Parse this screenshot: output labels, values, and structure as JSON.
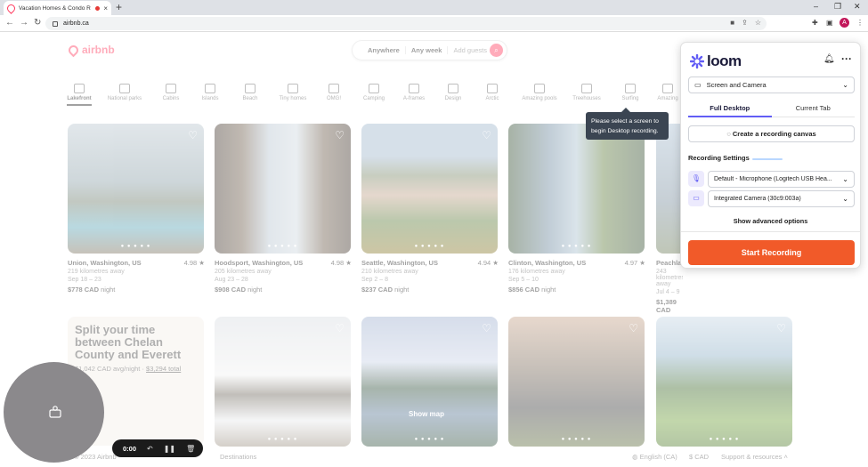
{
  "browser": {
    "tab_title": "Vacation Homes & Condo R",
    "tab_close": "×",
    "new_tab": "+",
    "url": "airbnb.ca",
    "profile_initial": "A",
    "window_controls": [
      "–",
      "❐",
      "✕"
    ]
  },
  "airbnb": {
    "logo_text": "airbnb",
    "search": {
      "anywhere": "Anywhere",
      "any_week": "Any week",
      "add_guests": "Add guests"
    },
    "categories": [
      "Lakefront",
      "National parks",
      "Cabins",
      "Islands",
      "Beach",
      "Tiny homes",
      "OMG!",
      "Camping",
      "A-frames",
      "Design",
      "Arctic",
      "Amazing pools",
      "Treehouses",
      "Surfing",
      "Amazing"
    ],
    "listings": [
      {
        "place": "Union, Washington, US",
        "rating": "4.98 ★",
        "distance": "219 kilometres away",
        "dates": "Sep 18 – 23",
        "price": "$778 CAD",
        "per": "night"
      },
      {
        "place": "Hoodsport, Washington, US",
        "rating": "4.98 ★",
        "distance": "205 kilometres away",
        "dates": "Aug 23 – 28",
        "price": "$908 CAD",
        "per": "night"
      },
      {
        "place": "Seattle, Washington, US",
        "rating": "4.94 ★",
        "distance": "210 kilometres away",
        "dates": "Sep 2 – 8",
        "price": "$237 CAD",
        "per": "night"
      },
      {
        "place": "Clinton, Washington, US",
        "rating": "4.97 ★",
        "distance": "176 kilometres away",
        "dates": "Sep 5 – 10",
        "price": "$856 CAD",
        "per": "night"
      },
      {
        "place": "Peachland",
        "rating": "",
        "distance": "243 kilometres away",
        "dates": "Jul 4 – 9",
        "price": "$1,389 CAD",
        "per": "night"
      }
    ],
    "promo": {
      "heading": "Split your time between Chelan County and Everett",
      "price_line": "$1,042 CAD avg/night · ",
      "total": "$3,294 total"
    },
    "show_map": "Show map",
    "footer_left": "© 2023 Airbnb",
    "footer_destinations": "Destinations",
    "footer_language": "English (CA)",
    "footer_currency": "$ CAD",
    "footer_support": "Support & resources"
  },
  "tooltip": {
    "line1": "Please select a screen to",
    "line2": "begin Desktop recording."
  },
  "loom": {
    "brand": "loom",
    "mode_select": "Screen and Camera",
    "tabs": [
      "Full Desktop",
      "Current Tab"
    ],
    "canvas_button": "Create a recording canvas",
    "settings_label": "Recording Settings",
    "microphone": "Default - Microphone (Logitech USB Hea...",
    "camera": "Integrated Camera (30c9:003a)",
    "advanced": "Show advanced options",
    "start": "Start Recording",
    "accent": "#625df5",
    "start_color": "#f15a29"
  },
  "recorder": {
    "time": "0:00"
  }
}
